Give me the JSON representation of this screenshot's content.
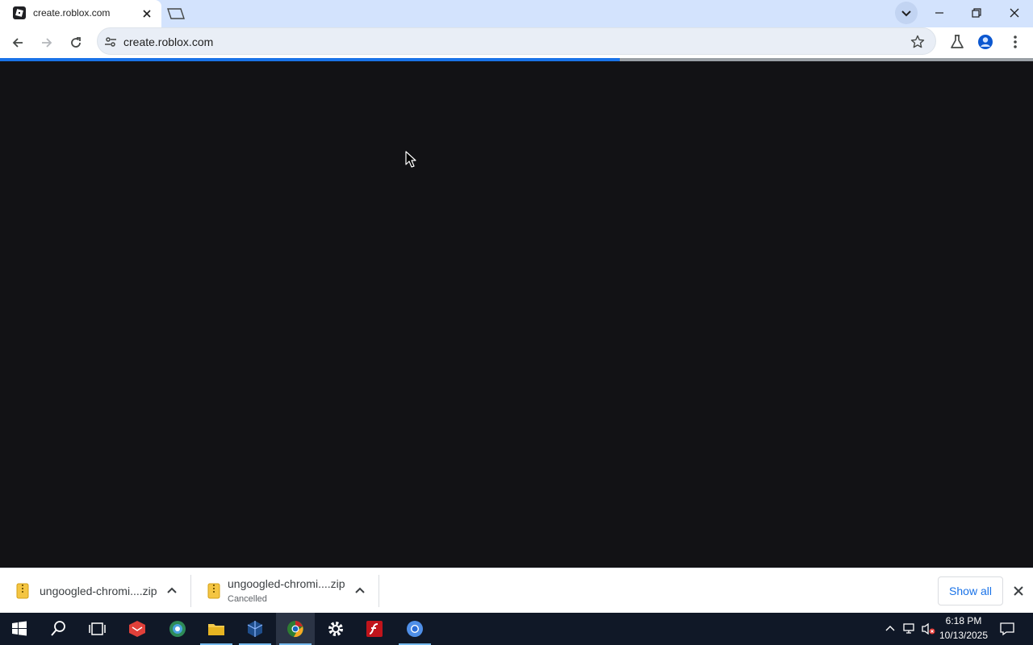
{
  "browser": {
    "tab_title": "create.roblox.com",
    "url": "create.roblox.com",
    "load_progress": 0.6
  },
  "downloads": [
    {
      "name": "ungoogled-chromi....zip",
      "status": ""
    },
    {
      "name": "ungoogled-chromi....zip",
      "status": "Cancelled"
    }
  ],
  "shelf": {
    "show_all_label": "Show all"
  },
  "taskbar": {
    "time": "6:18 PM",
    "date": "10/13/2025",
    "apps": [
      "start-icon",
      "search-icon",
      "task-view-icon",
      "app-red-icon",
      "globe-icon",
      "file-explorer-icon",
      "virtualbox-icon",
      "chrome-icon",
      "settings-icon",
      "flash-icon",
      "chromium-icon"
    ]
  },
  "colors": {
    "page_bg": "#121215",
    "accent": "#1a73e8",
    "tab_strip": "#d3e3fd",
    "taskbar": "#101827"
  }
}
